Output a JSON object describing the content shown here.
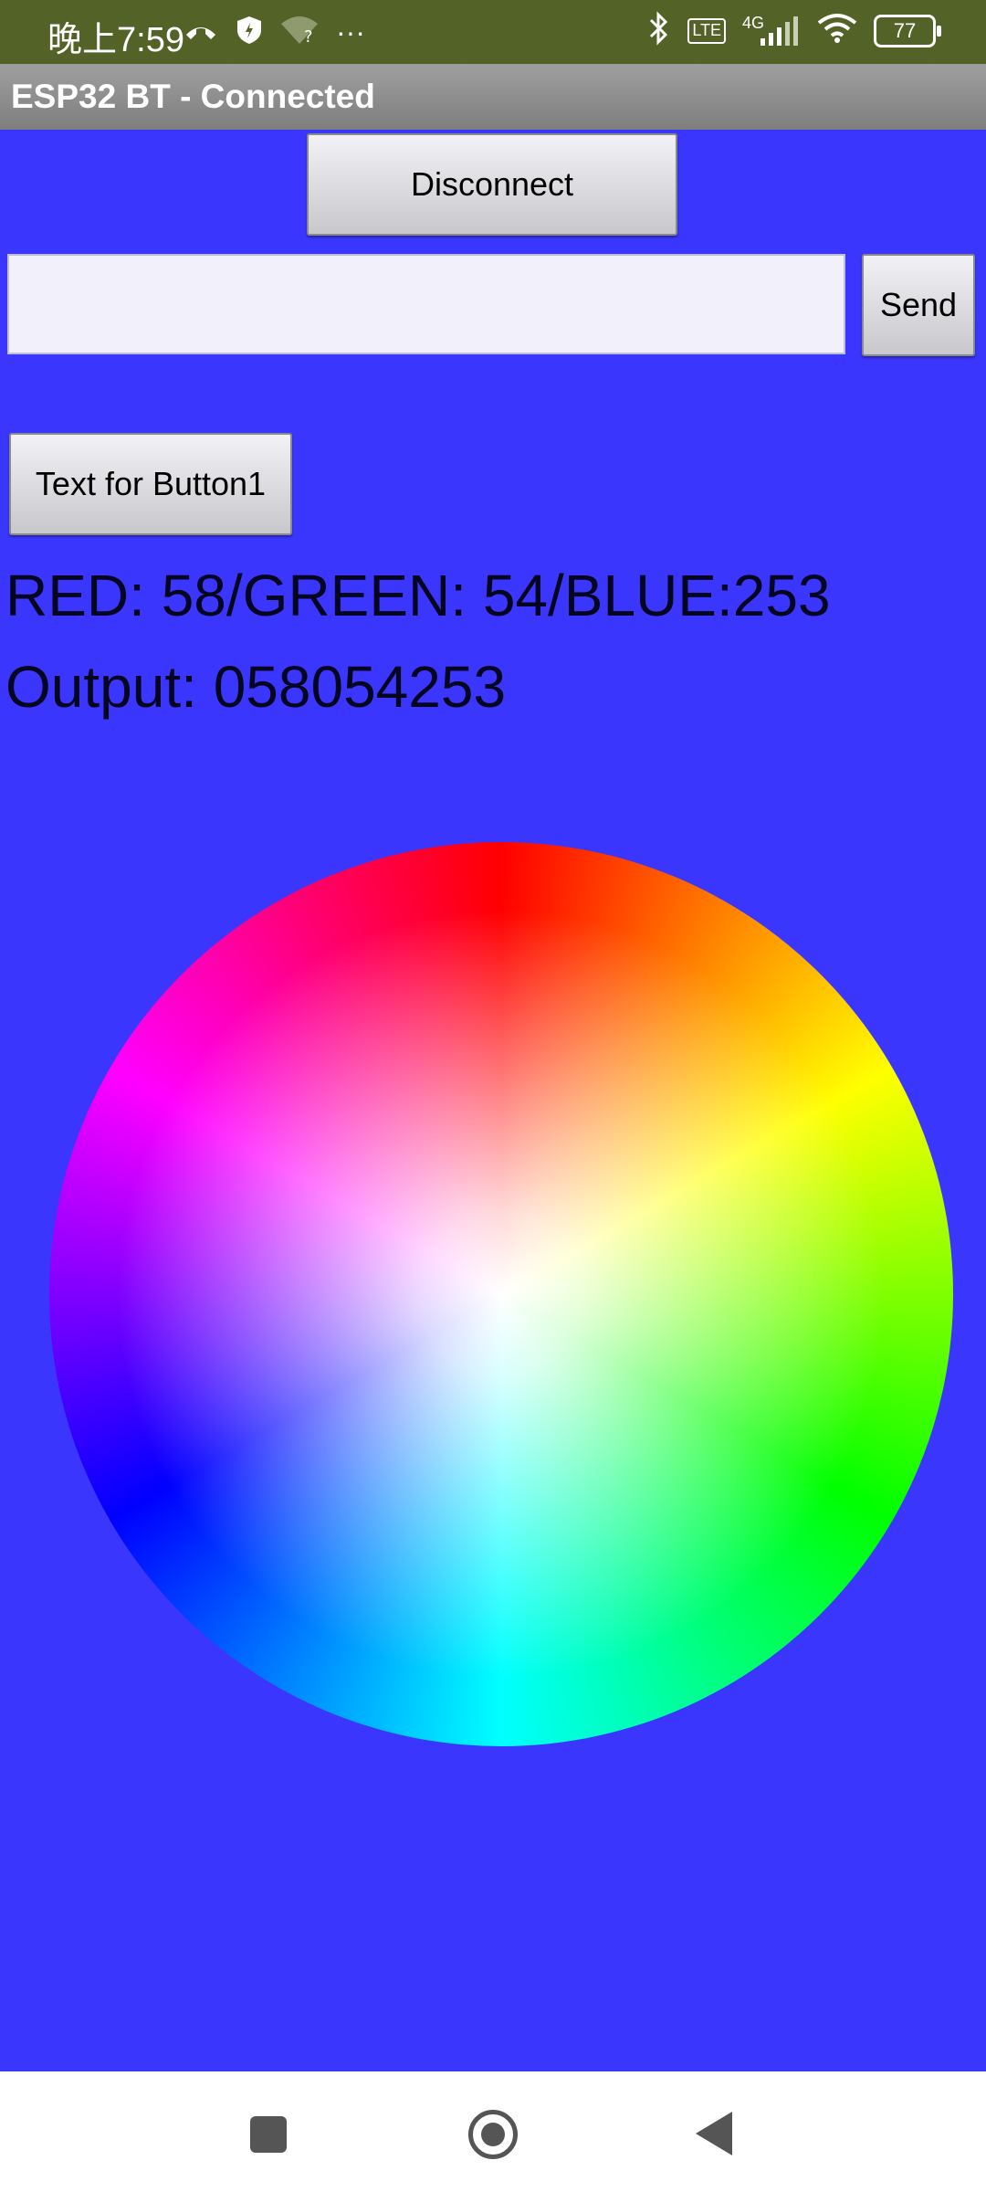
{
  "status_bar": {
    "time": "晚上7:59",
    "more": "···",
    "wifi_question": "?",
    "network_lte": "LTE",
    "network_4g": "4G",
    "battery": "77"
  },
  "app": {
    "title": "ESP32 BT - Connected"
  },
  "controls": {
    "disconnect_label": "Disconnect",
    "text_input_value": "",
    "send_label": "Send",
    "button1_label": "Text for Button1"
  },
  "readout": {
    "rgb_text": "RED: 58/GREEN: 54/BLUE:253",
    "output_text": "Output: 058054253"
  },
  "colors": {
    "background": "#3a36fd",
    "status_bar": "#536327",
    "title_bar": "#8f8f8f"
  }
}
